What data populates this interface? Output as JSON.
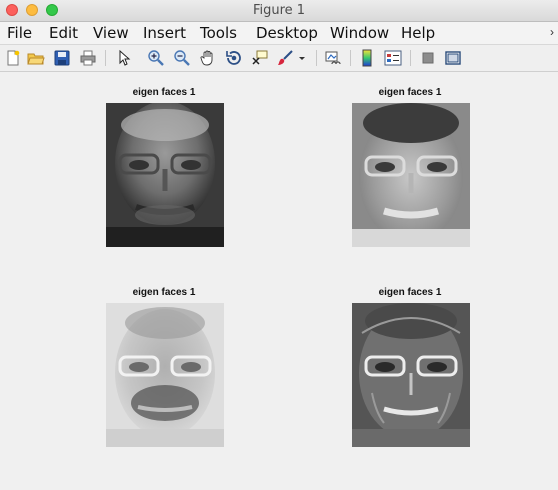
{
  "window": {
    "title": "Figure 1"
  },
  "menu": {
    "items": [
      "File",
      "Edit",
      "View",
      "Insert",
      "Tools",
      "Desktop",
      "Window",
      "Help"
    ],
    "overflow_icon": "chevron-right-icon"
  },
  "toolbar": {
    "icons": [
      "new-figure-icon",
      "open-file-icon",
      "save-icon",
      "print-icon",
      "pointer-icon",
      "zoom-in-icon",
      "zoom-out-icon",
      "pan-hand-icon",
      "rotate-3d-icon",
      "data-cursor-icon",
      "brush-icon",
      "brush-dropdown-icon",
      "link-plot-icon",
      "colorbar-icon",
      "legend-icon",
      "hide-plot-tools-icon",
      "show-plot-tools-icon"
    ]
  },
  "plots": [
    {
      "title": "eigen faces 1"
    },
    {
      "title": "eigen faces 1"
    },
    {
      "title": "eigen faces 1"
    },
    {
      "title": "eigen faces 1"
    }
  ]
}
